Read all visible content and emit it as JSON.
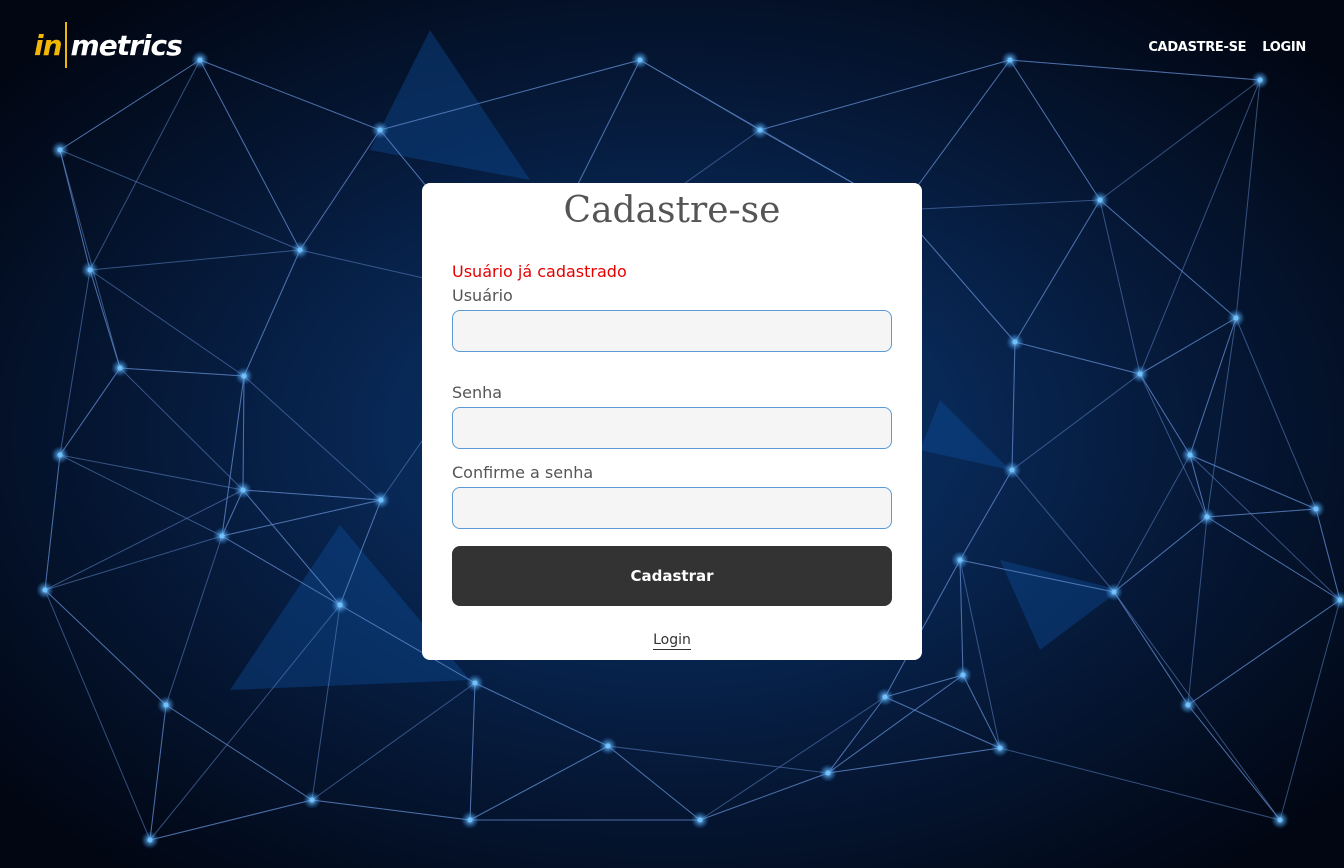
{
  "brand": {
    "logo_in": "in",
    "logo_metrics": "metrics",
    "accent_color": "#f2b705"
  },
  "nav": {
    "items": [
      "CADASTRE-SE",
      "LOGIN"
    ]
  },
  "form": {
    "title": "Cadastre-se",
    "error": "Usuário já cadastrado",
    "fields": [
      {
        "label": "Usuário",
        "value": "",
        "placeholder": ""
      },
      {
        "label": "Senha",
        "value": "",
        "placeholder": ""
      },
      {
        "label": "Confirme a senha",
        "value": "",
        "placeholder": ""
      }
    ],
    "submit_label": "Cadastrar",
    "login_link": "Login"
  },
  "colors": {
    "error": "#e60000",
    "button": "#333333",
    "input_border": "#5a9ad6",
    "background": "#020a1a"
  }
}
